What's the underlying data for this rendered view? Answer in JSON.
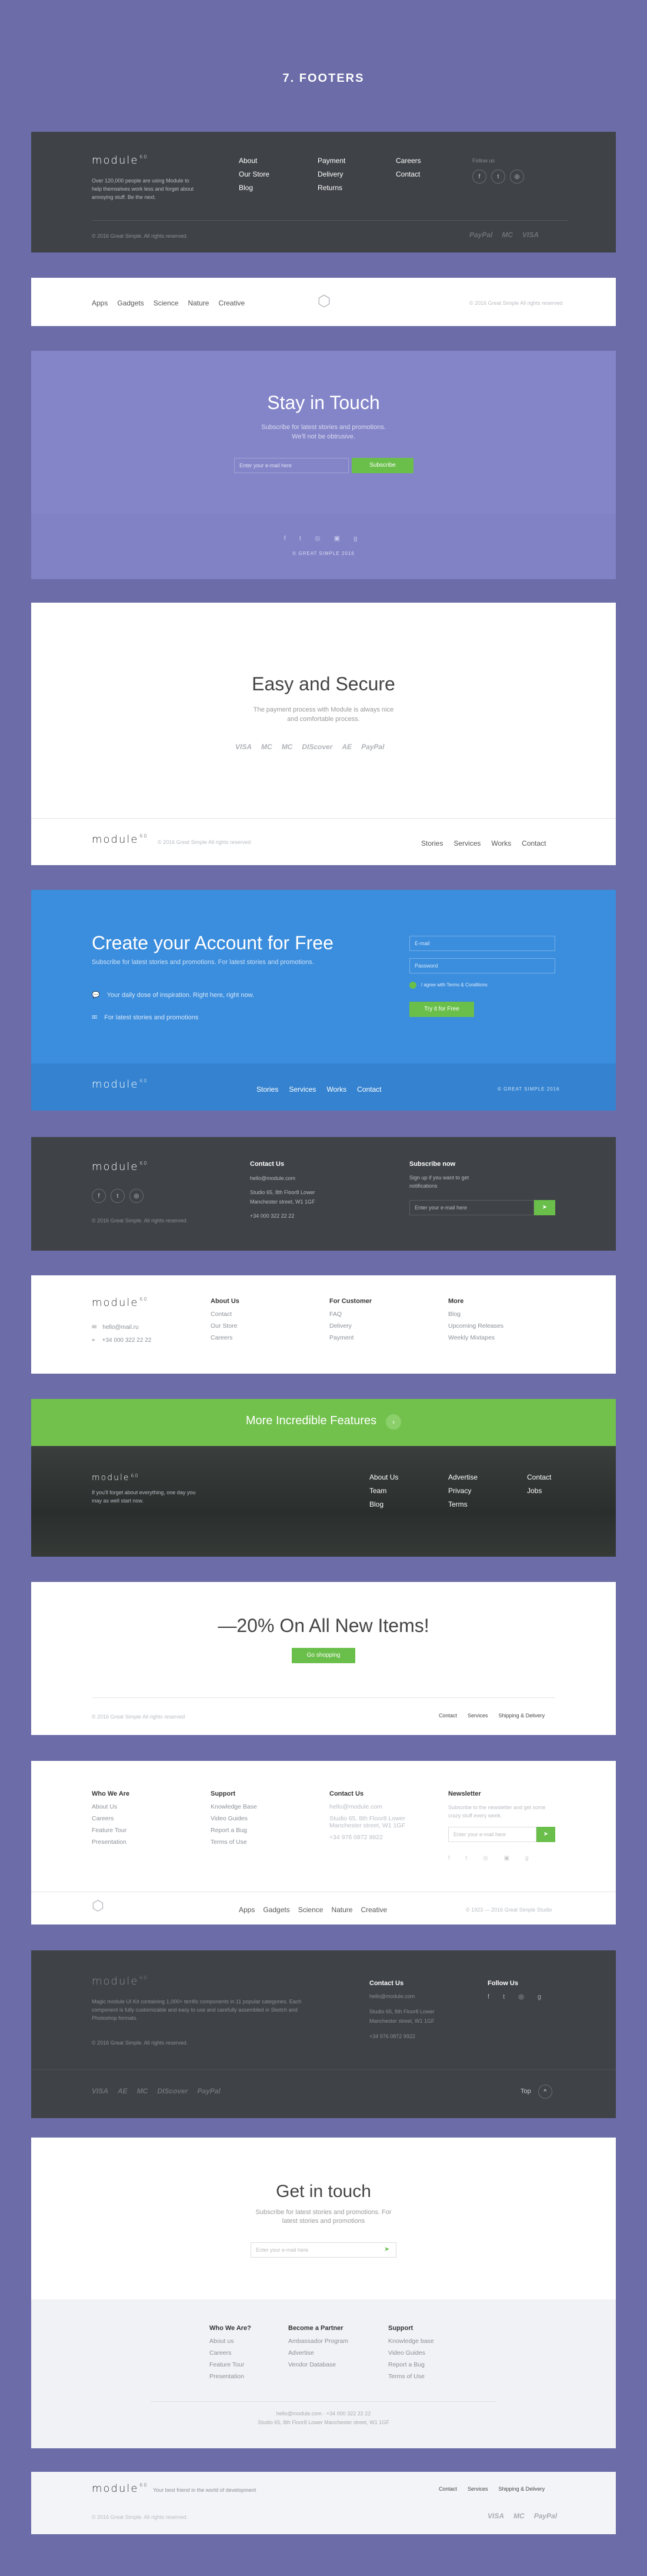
{
  "page_title": "7. FOOTERS",
  "brand": "module",
  "brand_sup": "60",
  "f1": {
    "desc": "Over 120,000 people are using Module to help themselves work less and forget about annoying stuff. Be the next.",
    "col1": [
      "About",
      "Our Store",
      "Blog"
    ],
    "col2": [
      "Payment",
      "Delivery",
      "Returns"
    ],
    "col3": [
      "Careers",
      "Contact"
    ],
    "follow": "Follow us",
    "copy": "© 2016 Great Simple. All rights reserved.",
    "pay": [
      "PayPal",
      "MC",
      "VISA"
    ]
  },
  "f2": {
    "links": [
      "Apps",
      "Gadgets",
      "Science",
      "Nature",
      "Creative"
    ],
    "copy": "© 2016 Great Simple All rights reserved"
  },
  "f3": {
    "title": "Stay in Touch",
    "sub1": "Subscribe for latest stories and promotions.",
    "sub2": "We'll not be obtrusive.",
    "placeholder": "Enter your e-mail here",
    "button": "Subscribe",
    "credit": "© GREAT SIMPLE 2016"
  },
  "f4": {
    "title": "Easy and Secure",
    "sub1": "The payment process with Module is always nice",
    "sub2": "and comfortable process.",
    "pay": [
      "VISA",
      "MC",
      "MC",
      "DIScover",
      "AE",
      "PayPal"
    ],
    "copy": "© 2016 Great Simple All rights reserved",
    "links": [
      "Stories",
      "Services",
      "Works",
      "Contact"
    ]
  },
  "f5": {
    "title": "Create your Account for Free",
    "sub": "Subscribe for latest stories and promotions. For latest stories and promotions.",
    "item1": "Your daily dose of inspiration. Right here, right now.",
    "item2": "For latest stories and promotions",
    "email": "E-mail",
    "password": "Password",
    "agree": "I agree with Terms & Conditions",
    "button": "Try it for Free",
    "links": [
      "Stories",
      "Services",
      "Works",
      "Contact"
    ],
    "credit": "© GREAT SIMPLE 2016"
  },
  "f6": {
    "contact": "Contact Us",
    "email": "hello@module.com",
    "addr1": "Studio 65, 8th Floor8 Lower",
    "addr2": "Manchester street, W1 1GF",
    "phone": "+34 000 322 22 22",
    "subscribe": "Subscribe now",
    "subtext": "Sign up if you want to get notifications",
    "placeholder": "Enter your e-mail here",
    "copy": "© 2016 Great Simple. All rights reserved."
  },
  "f7": {
    "email": "hello@mail.ru",
    "phone": "+34 000 322 22 22",
    "c1t": "About Us",
    "c1": [
      "Contact",
      "Our Store",
      "Careers"
    ],
    "c2t": "For Customer",
    "c2": [
      "FAQ",
      "Delivery",
      "Payment"
    ],
    "c3t": "More",
    "c3": [
      "Blog",
      "Upcoming Releases",
      "Weekly Mixtapes"
    ]
  },
  "f8": {
    "banner": "More Incredible Features",
    "desc": "If you'll forget about everything, one day you may as well start now.",
    "c1": [
      "About Us",
      "Team",
      "Blog"
    ],
    "c2": [
      "Advertise",
      "Privacy",
      "Terms"
    ],
    "c3": [
      "Contact",
      "Jobs"
    ]
  },
  "f9": {
    "title": "—20% On All New Items!",
    "button": "Go shopping",
    "copy": "© 2016 Great Simple All rights reserved",
    "links": [
      "Contact",
      "Services",
      "Shipping & Delivery"
    ]
  },
  "f10": {
    "c1t": "Who We Are",
    "c1": [
      "About Us",
      "Careers",
      "Feature Tour",
      "Presentation"
    ],
    "c2t": "Support",
    "c2": [
      "Knowledge Base",
      "Video Guides",
      "Report a Bug",
      "Terms of Use"
    ],
    "c3t": "Contact Us",
    "c3": [
      "hello@module.com",
      "Studio 65, 8th Floor8 Lower",
      "Manchester street, W1 1GF",
      "+34 976 0872 9922"
    ],
    "c4t": "Newsletter",
    "c4s": "Subscribe to the newsletter and get some crazy stuff every week.",
    "placeholder": "Enter your e-mail here",
    "links": [
      "Apps",
      "Gadgets",
      "Science",
      "Nature",
      "Creative"
    ],
    "copy": "© 1923 — 2016 Great Simple Studio"
  },
  "f11": {
    "desc": "Magic module UI Kit containing 1,000+ terrific components in 11 popular categories. Each component is fully customizable and easy to use and carefully assembled in Sketch and Photoshop formats.",
    "copy": "© 2016 Great Simple. All rights reserved.",
    "contact": "Contact Us",
    "email": "hello@module.com",
    "addr1": "Studio 65, 8th Floor8 Lower",
    "addr2": "Manchester street, W1 1GF",
    "phone": "+34 976 0872 9922",
    "follow": "Follow Us",
    "pay": [
      "VISA",
      "AE",
      "MC",
      "DIScover",
      "PayPal"
    ],
    "top": "Top"
  },
  "f12": {
    "title": "Get in touch",
    "sub1": "Subscribe for latest stories and promotions. For",
    "sub2": "latest stories and promotions",
    "placeholder": "Enter your e-mail here",
    "c1t": "Who We Are?",
    "c1": [
      "About us",
      "Careers",
      "Feature Tour",
      "Presentation"
    ],
    "c2t": "Become a Partner",
    "c2": [
      "Ambassador Program",
      "Advertise",
      "Vendor Database"
    ],
    "c3t": "Support",
    "c3": [
      "Knowledge base",
      "Video Guides",
      "Report a Bug",
      "Terms of Use"
    ],
    "contact": "hello@module.com · +34 000 322 22 22",
    "addr": "Studio 65, 8th Floor8 Lower Manchester street, W1 1GF"
  },
  "f13": {
    "tag": "Your best friend in the world of development",
    "copy": "© 2016 Great Simple. All rights reserved.",
    "links": [
      "Contact",
      "Services",
      "Shipping & Delivery"
    ],
    "pay": [
      "VISA",
      "MC",
      "PayPal"
    ]
  }
}
